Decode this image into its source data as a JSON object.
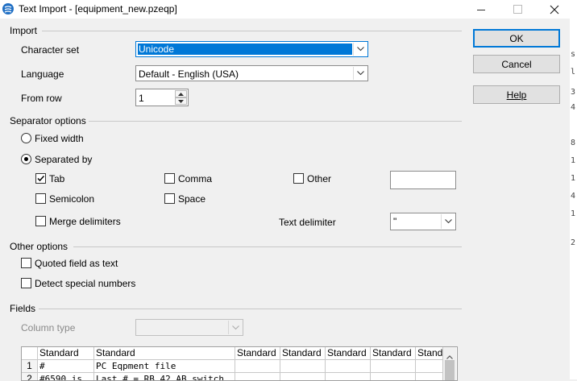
{
  "window": {
    "title": "Text Import - [equipment_new.pzeqp]"
  },
  "buttons": {
    "ok": "OK",
    "cancel": "Cancel",
    "help": "Help"
  },
  "import": {
    "section": "Import",
    "charset_label": "Character set",
    "charset_value": "Unicode",
    "language_label": "Language",
    "language_value": "Default - English (USA)",
    "from_row_label": "From row",
    "from_row_value": "1"
  },
  "separator": {
    "section": "Separator options",
    "fixed_width": "Fixed width",
    "separated_by": "Separated by",
    "tab": "Tab",
    "comma": "Comma",
    "other": "Other",
    "other_value": "",
    "semicolon": "Semicolon",
    "space": "Space",
    "merge": "Merge delimiters",
    "text_delimiter_label": "Text delimiter",
    "text_delimiter_value": "\""
  },
  "other_options": {
    "section": "Other options",
    "quoted": "Quoted field as text",
    "detect": "Detect special numbers"
  },
  "fields": {
    "section": "Fields",
    "column_type_label": "Column type",
    "column_type_value": "",
    "headers": [
      "Standard",
      "Standard",
      "Standard",
      "Standard",
      "Standard",
      "Standard",
      "Stand"
    ],
    "rows": [
      {
        "num": "1",
        "cells": [
          "#",
          "PC Eqpment file",
          "",
          "",
          "",
          "",
          ""
        ]
      },
      {
        "num": "2",
        "cells": [
          "#6590 is",
          "Last # = RB 42 AB switch",
          "",
          "",
          "",
          "",
          ""
        ]
      }
    ]
  },
  "background_strip": [
    "s",
    "l",
    "3",
    "4",
    "8",
    "1",
    "1",
    "4",
    "1",
    "2"
  ],
  "colors": {
    "accent": "#0078d7",
    "window_bg": "#f0f0f0"
  }
}
